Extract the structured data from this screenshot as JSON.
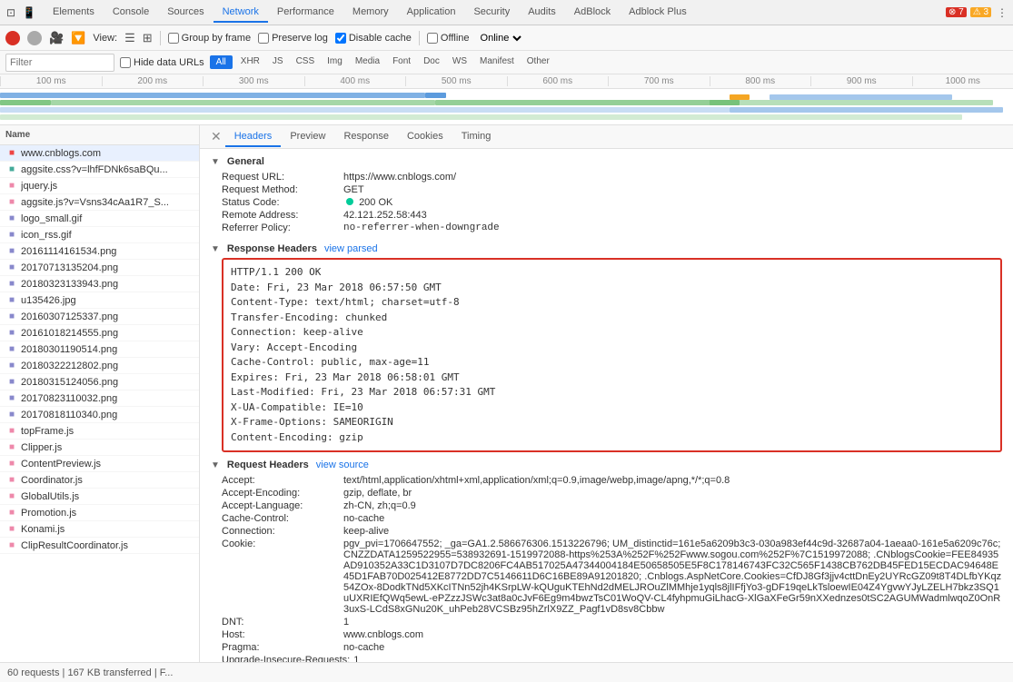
{
  "tabs": {
    "items": [
      "Elements",
      "Console",
      "Sources",
      "Network",
      "Performance",
      "Memory",
      "Application",
      "Security",
      "Audits",
      "AdBlock",
      "Adblock Plus"
    ],
    "active": "Network"
  },
  "badges": {
    "error": "7",
    "warn": "3"
  },
  "toolbar": {
    "view_label": "View:",
    "group_by_frame_label": "Group by frame",
    "preserve_log_label": "Preserve log",
    "disable_cache_label": "Disable cache",
    "offline_label": "Offline",
    "online_label": "Online"
  },
  "filter": {
    "placeholder": "Filter",
    "hide_data_urls_label": "Hide data URLs",
    "types": [
      "All",
      "XHR",
      "JS",
      "CSS",
      "Img",
      "Media",
      "Font",
      "Doc",
      "WS",
      "Manifest",
      "Other"
    ],
    "active_type": "All"
  },
  "timeline": {
    "ticks": [
      "100 ms",
      "200 ms",
      "300 ms",
      "400 ms",
      "500 ms",
      "600 ms",
      "700 ms",
      "800 ms",
      "900 ms",
      "1000 ms"
    ]
  },
  "file_list": {
    "column": "Name",
    "items": [
      {
        "name": "www.cnblogs.com",
        "type": "html",
        "selected": true
      },
      {
        "name": "aggsite.css?v=lhfFDNk6saBQu...",
        "type": "css"
      },
      {
        "name": "jquery.js",
        "type": "js"
      },
      {
        "name": "aggsite.js?v=Vsns34cAa1R7_S...",
        "type": "js"
      },
      {
        "name": "logo_small.gif",
        "type": "img"
      },
      {
        "name": "icon_rss.gif",
        "type": "img"
      },
      {
        "name": "20161114161534.png",
        "type": "img"
      },
      {
        "name": "20170713135204.png",
        "type": "img"
      },
      {
        "name": "20180323133943.png",
        "type": "img"
      },
      {
        "name": "u135426.jpg",
        "type": "img"
      },
      {
        "name": "20160307125337.png",
        "type": "img"
      },
      {
        "name": "20161018214555.png",
        "type": "img"
      },
      {
        "name": "20180301190514.png",
        "type": "img"
      },
      {
        "name": "20180322212802.png",
        "type": "img"
      },
      {
        "name": "20180315124056.png",
        "type": "img"
      },
      {
        "name": "20170823110032.png",
        "type": "img"
      },
      {
        "name": "20170818110340.png",
        "type": "img"
      },
      {
        "name": "topFrame.js",
        "type": "js"
      },
      {
        "name": "Clipper.js",
        "type": "js"
      },
      {
        "name": "ContentPreview.js",
        "type": "js"
      },
      {
        "name": "Coordinator.js",
        "type": "js"
      },
      {
        "name": "GlobalUtils.js",
        "type": "js"
      },
      {
        "name": "Promotion.js",
        "type": "js"
      },
      {
        "name": "Konami.js",
        "type": "js"
      },
      {
        "name": "ClipResultCoordinator.js",
        "type": "js"
      }
    ]
  },
  "detail": {
    "tabs": [
      "Headers",
      "Preview",
      "Response",
      "Cookies",
      "Timing"
    ],
    "active_tab": "Headers",
    "general": {
      "title": "General",
      "request_url": "https://www.cnblogs.com/",
      "request_method": "GET",
      "status_code": "200  OK",
      "remote_address": "42.121.252.58:443",
      "referrer_policy": "no-referrer-when-downgrade"
    },
    "response_headers": {
      "title": "Response Headers",
      "view_link": "view parsed",
      "lines": [
        "HTTP/1.1 200 OK",
        "Date: Fri, 23 Mar 2018 06:57:50 GMT",
        "Content-Type: text/html; charset=utf-8",
        "Transfer-Encoding: chunked",
        "Connection: keep-alive",
        "Vary: Accept-Encoding",
        "Cache-Control: public, max-age=11",
        "Expires: Fri, 23 Mar 2018 06:58:01 GMT",
        "Last-Modified: Fri, 23 Mar 2018 06:57:31 GMT",
        "X-UA-Compatible: IE=10",
        "X-Frame-Options: SAMEORIGIN",
        "Content-Encoding: gzip"
      ]
    },
    "request_headers": {
      "title": "Request Headers",
      "view_link": "view source",
      "rows": [
        {
          "key": "Accept:",
          "val": "text/html,application/xhtml+xml,application/xml;q=0.9,image/webp,image/apng,*/*;q=0.8"
        },
        {
          "key": "Accept-Encoding:",
          "val": "gzip, deflate, br"
        },
        {
          "key": "Accept-Language:",
          "val": "zh-CN, zh;q=0.9"
        },
        {
          "key": "Cache-Control:",
          "val": "no-cache"
        },
        {
          "key": "Connection:",
          "val": "keep-alive"
        },
        {
          "key": "Cookie:",
          "val": "pgv_pvi=1706647552; _ga=GA1.2.586676306.1513226796; UM_distinctid=161e5a6209b3c3-030a983ef44c9d-32687a04-1aeaa0-161e5a6209c76c; CNZZDATA1259522955=538932691-1519972088-https%253A%252F%252Fwww.sogou.com%252F%7C1519972088; .CNblogsCookie=FEE84935AD910352A33C1D3107D7DC8206FC4AB517025A47344004184E50658505E5F8C178146743FC32C565F1438CB762DB45FED15ECDAC94648E45D1FAB70D025412E8772DD7C5146611D6C16BE89A91201820; .Cnblogs.AspNetCore.Cookies=CfDJ8Gf3jjv4cttDnEy2UYRcGZ09t8T4DLfbYKqz54ZOx-8DodkTNd5XKcITNn52jh4KSrpLW-kQUguKTEhNd2dMELJROuZlMMhje1yqls8jlIFfjYo3-gDF19qeLkTsloewIE04Z4YgvwYJyLZELH7bkz3SQ1uUXRIEfQWq5ewL-ePZzzJSWc3at8a0cJvF6Eg9m4bwzTsC01WoQV-CL4fyhpmuGiLhacG-XlGaXFeGr59nXXednzes0tSC2AGUMWadmlwqoZ0OnR3uxS-LCdS8xGNu20K_uhPeb28VCSBz95hZrlX9ZZ_Pagf1vD8sv8Cbbw"
        },
        {
          "key": "DNT:",
          "val": "1"
        },
        {
          "key": "Host:",
          "val": "www.cnblogs.com"
        },
        {
          "key": "Pragma:",
          "val": "no-cache"
        },
        {
          "key": "Upgrade-Insecure-Requests:",
          "val": "1"
        }
      ]
    }
  },
  "status_bar": {
    "text": "60 requests | 167 KB transferred | F..."
  }
}
